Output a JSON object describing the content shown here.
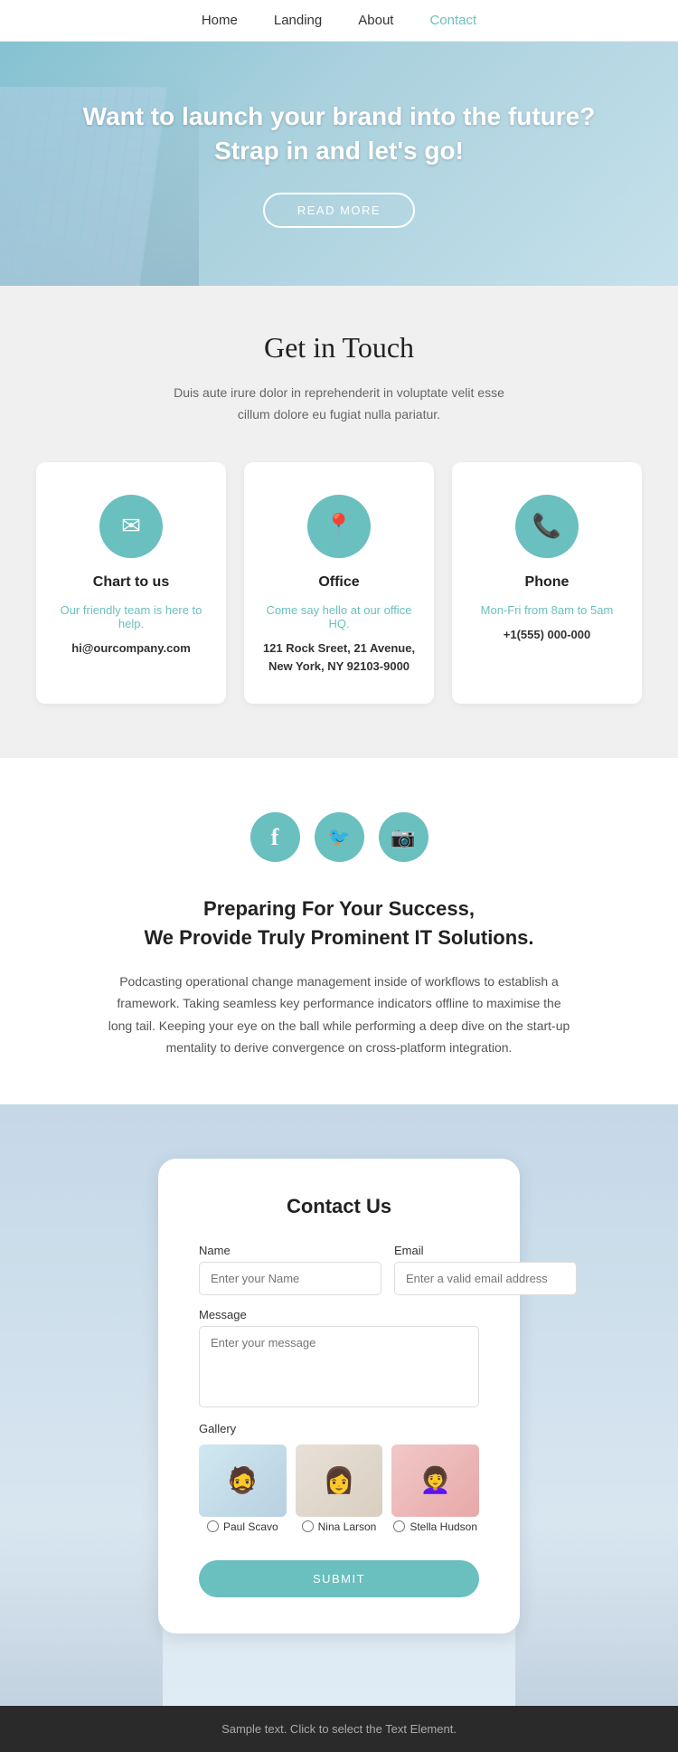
{
  "nav": {
    "items": [
      {
        "label": "Home",
        "href": "#",
        "active": false
      },
      {
        "label": "Landing",
        "href": "#",
        "active": false
      },
      {
        "label": "About",
        "href": "#",
        "active": false
      },
      {
        "label": "Contact",
        "href": "#",
        "active": true
      }
    ]
  },
  "hero": {
    "title": "Want to launch your brand into the future? Strap in and let's go!",
    "button_label": "READ MORE"
  },
  "get_in_touch": {
    "title": "Get in Touch",
    "subtitle_line1": "Duis aute irure dolor in reprehenderit in voluptate velit esse",
    "subtitle_line2": "cillum dolore eu fugiat nulla pariatur.",
    "cards": [
      {
        "icon": "✉",
        "title": "Chart to us",
        "link_text": "Our friendly team is here to help.",
        "detail": "hi@ourcompany.com"
      },
      {
        "icon": "📍",
        "title": "Office",
        "link_text": "Come say hello at our office HQ.",
        "detail": "121 Rock Sreet, 21 Avenue,\nNew York, NY 92103-9000"
      },
      {
        "icon": "📞",
        "title": "Phone",
        "link_text": "Mon-Fri from 8am to 5am",
        "detail": "+1(555) 000-000"
      }
    ]
  },
  "social": {
    "icons": [
      {
        "name": "facebook-icon",
        "symbol": "f"
      },
      {
        "name": "twitter-icon",
        "symbol": "t"
      },
      {
        "name": "instagram-icon",
        "symbol": "◎"
      }
    ]
  },
  "preparing": {
    "title": "Preparing For Your Success,\nWe Provide Truly Prominent IT Solutions.",
    "text": "Podcasting operational change management inside of workflows to establish a framework. Taking seamless key performance indicators offline to maximise the long tail. Keeping your eye on the ball while performing a deep dive on the start-up mentality to derive convergence on cross-platform integration."
  },
  "contact_form": {
    "title": "Contact Us",
    "name_label": "Name",
    "name_placeholder": "Enter your Name",
    "email_label": "Email",
    "email_placeholder": "Enter a valid email address",
    "message_label": "Message",
    "message_placeholder": "Enter your message",
    "gallery_label": "Gallery",
    "gallery_items": [
      {
        "name": "Paul Scavo",
        "color": "#d0e8f0"
      },
      {
        "name": "Nina Larson",
        "color": "#e8e0d8"
      },
      {
        "name": "Stella Hudson",
        "color": "#f0c8c8"
      }
    ],
    "submit_label": "SUBMIT"
  },
  "footer": {
    "text": "Sample text. Click to select the Text Element."
  }
}
